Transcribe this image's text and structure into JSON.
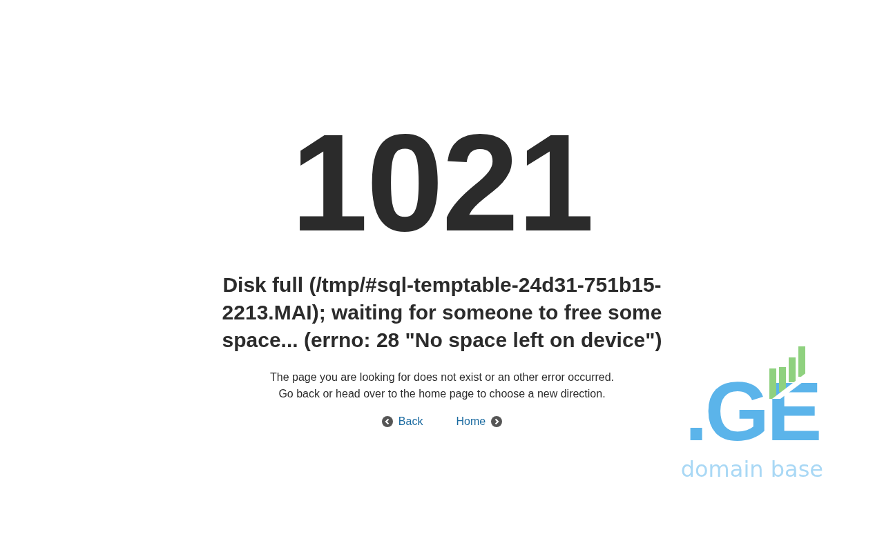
{
  "error": {
    "code": "1021",
    "message": "Disk full (/tmp/#sql-temptable-24d31-751b15-2213.MAI); waiting for someone to free some space... (errno: 28 \"No space left on device\")",
    "lines": [
      "The page you are looking for does not exist or an other error occurred.",
      "Go back or head over to the home page to choose a new direction."
    ]
  },
  "links": [
    {
      "kind": "back",
      "label": "Back"
    },
    {
      "kind": "home",
      "label": "Home"
    }
  ],
  "logo": {
    "mark": ".GE",
    "tagline": "domain base"
  }
}
